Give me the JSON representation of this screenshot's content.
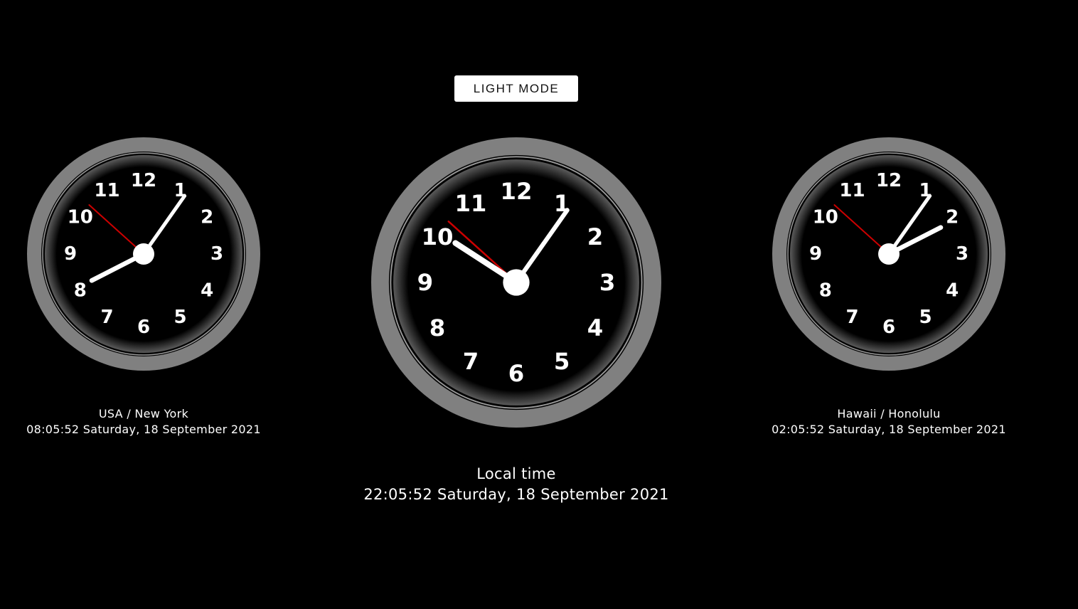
{
  "theme": {
    "background": "#000000",
    "text": "#ffffff",
    "bezel": "#808080",
    "face": "#000000",
    "second_hand": "#cc0000",
    "button_bg": "#ffffff"
  },
  "toolbar": {
    "mode_button_label": "LIGHT MODE"
  },
  "clocks": {
    "numerals": [
      "12",
      "1",
      "2",
      "3",
      "4",
      "5",
      "6",
      "7",
      "8",
      "9",
      "10",
      "11"
    ],
    "new_york": {
      "location": "USA / New York",
      "datetime": "08:05:52 Saturday, 18 September 2021",
      "time": {
        "hours": 8,
        "minutes": 5,
        "seconds": 52
      }
    },
    "local": {
      "location": "Local time",
      "datetime": "22:05:52 Saturday, 18 September 2021",
      "time": {
        "hours": 22,
        "minutes": 5,
        "seconds": 52
      }
    },
    "honolulu": {
      "location": "Hawaii / Honolulu",
      "datetime": "02:05:52 Saturday, 18 September 2021",
      "time": {
        "hours": 2,
        "minutes": 5,
        "seconds": 52
      }
    }
  }
}
